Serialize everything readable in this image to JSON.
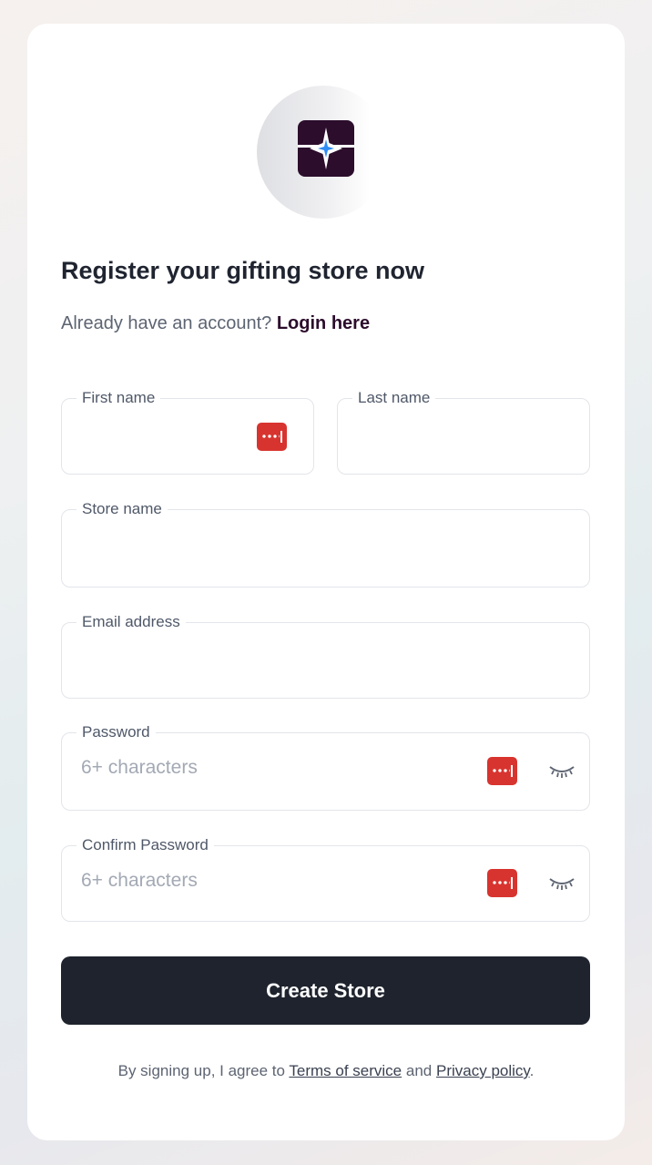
{
  "logo": {
    "icon": "sparkle-logo-icon",
    "tile_color": "#2c0d2c",
    "accent": "#2f8cf5"
  },
  "heading": "Register your gifting store now",
  "login_prompt": {
    "text": "Already have an account?",
    "link": "Login here"
  },
  "fields": {
    "first_name": {
      "label": "First name",
      "value": "",
      "placeholder": ""
    },
    "last_name": {
      "label": "Last name",
      "value": "",
      "placeholder": ""
    },
    "store_name": {
      "label": "Store name",
      "value": "",
      "placeholder": ""
    },
    "email": {
      "label": "Email address",
      "value": "",
      "placeholder": ""
    },
    "password": {
      "label": "Password",
      "value": "",
      "placeholder": "6+ characters"
    },
    "confirm_password": {
      "label": "Confirm Password",
      "value": "",
      "placeholder": "6+ characters"
    }
  },
  "icons": {
    "password_manager": "password-manager-icon",
    "toggle_visibility": "eye-closed-icon"
  },
  "submit_label": "Create Store",
  "terms": {
    "prefix": "By signing up, I agree to",
    "terms_link": "Terms of service",
    "conjunction": "and",
    "privacy_link": "Privacy policy",
    "suffix": "."
  },
  "colors": {
    "primary_button": "#1e232d",
    "password_manager": "#d8342f",
    "brand": "#2c0d2c"
  }
}
